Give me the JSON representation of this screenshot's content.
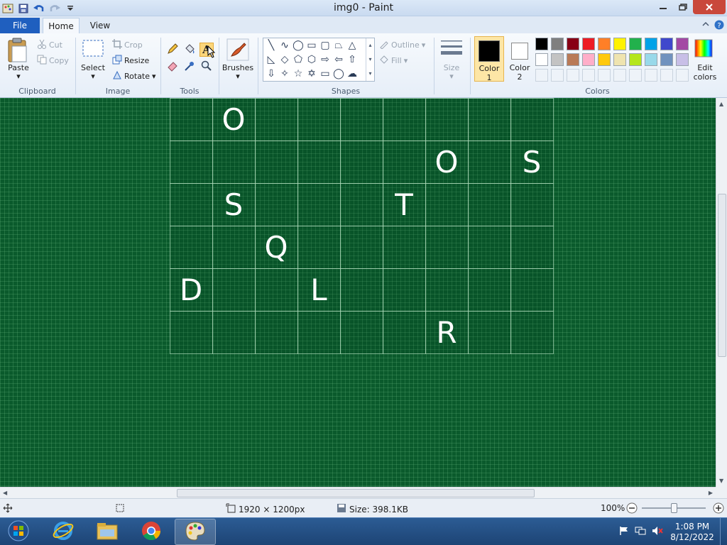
{
  "window": {
    "title": "img0 - Paint"
  },
  "tabs": {
    "file": "File",
    "home": "Home",
    "view": "View"
  },
  "ribbon": {
    "clipboard": {
      "paste": "Paste",
      "cut": "Cut",
      "copy": "Copy",
      "label": "Clipboard"
    },
    "image": {
      "select": "Select",
      "crop": "Crop",
      "resize": "Resize",
      "rotate": "Rotate",
      "label": "Image"
    },
    "tools": {
      "label": "Tools"
    },
    "brushes": {
      "label": "Brushes"
    },
    "shapes": {
      "outline": "Outline",
      "fill": "Fill",
      "label": "Shapes"
    },
    "size": {
      "label": "Size"
    },
    "colors": {
      "color1": "Color",
      "color1_num": "1",
      "color2": "Color",
      "color2_num": "2",
      "edit_label": "Edit",
      "edit_label2": "colors",
      "label": "Colors",
      "color1_value": "#000000",
      "color2_value": "#ffffff",
      "palette_row1": [
        "#000000",
        "#7f7f7f",
        "#880015",
        "#ed1c24",
        "#ff7f27",
        "#fff200",
        "#22b14c",
        "#00a2e8",
        "#3f48cc",
        "#a349a4"
      ],
      "palette_row2": [
        "#ffffff",
        "#c3c3c3",
        "#b97a57",
        "#ffaec9",
        "#ffc90e",
        "#efe4b0",
        "#b5e61d",
        "#99d9ea",
        "#7092be",
        "#c8bfe7"
      ]
    }
  },
  "canvas": {
    "letters": [
      {
        "text": "O",
        "row": 0,
        "col": 1
      },
      {
        "text": "O",
        "row": 1,
        "col": 6
      },
      {
        "text": "S",
        "row": 1,
        "col": 8
      },
      {
        "text": "S",
        "row": 2,
        "col": 1
      },
      {
        "text": "T",
        "row": 2,
        "col": 5
      },
      {
        "text": "Q",
        "row": 3,
        "col": 2
      },
      {
        "text": "D",
        "row": 4,
        "col": 0
      },
      {
        "text": "L",
        "row": 4,
        "col": 3
      },
      {
        "text": "R",
        "row": 5,
        "col": 6
      }
    ]
  },
  "status": {
    "dimensions": "1920 × 1200px",
    "size": "Size: 398.1KB",
    "zoom": "100%"
  },
  "taskbar": {
    "time": "1:08 PM",
    "date": "8/12/2022"
  }
}
